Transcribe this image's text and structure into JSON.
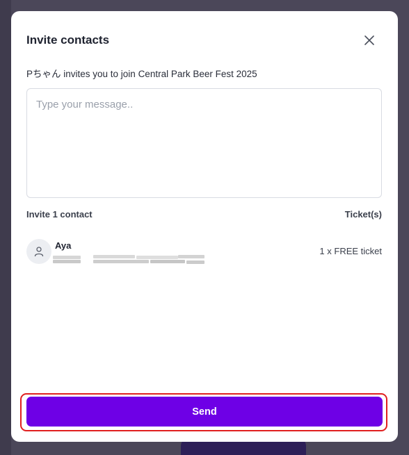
{
  "modal": {
    "title": "Invite contacts",
    "subtitle": "Pちゃん invites you to join Central Park Beer Fest 2025",
    "message": {
      "placeholder": "Type your message..",
      "value": ""
    },
    "invite_count_label": "Invite 1 contact",
    "tickets_header": "Ticket(s)",
    "contacts": [
      {
        "name": "Aya",
        "detail_obscured": true,
        "ticket": "1 x FREE ticket"
      }
    ],
    "send_label": "Send"
  },
  "icons": {
    "close": "close-icon",
    "avatar": "user-icon"
  },
  "colors": {
    "primary": "#6e00e6",
    "highlight": "#e01f1f",
    "text": "#1f2330"
  }
}
